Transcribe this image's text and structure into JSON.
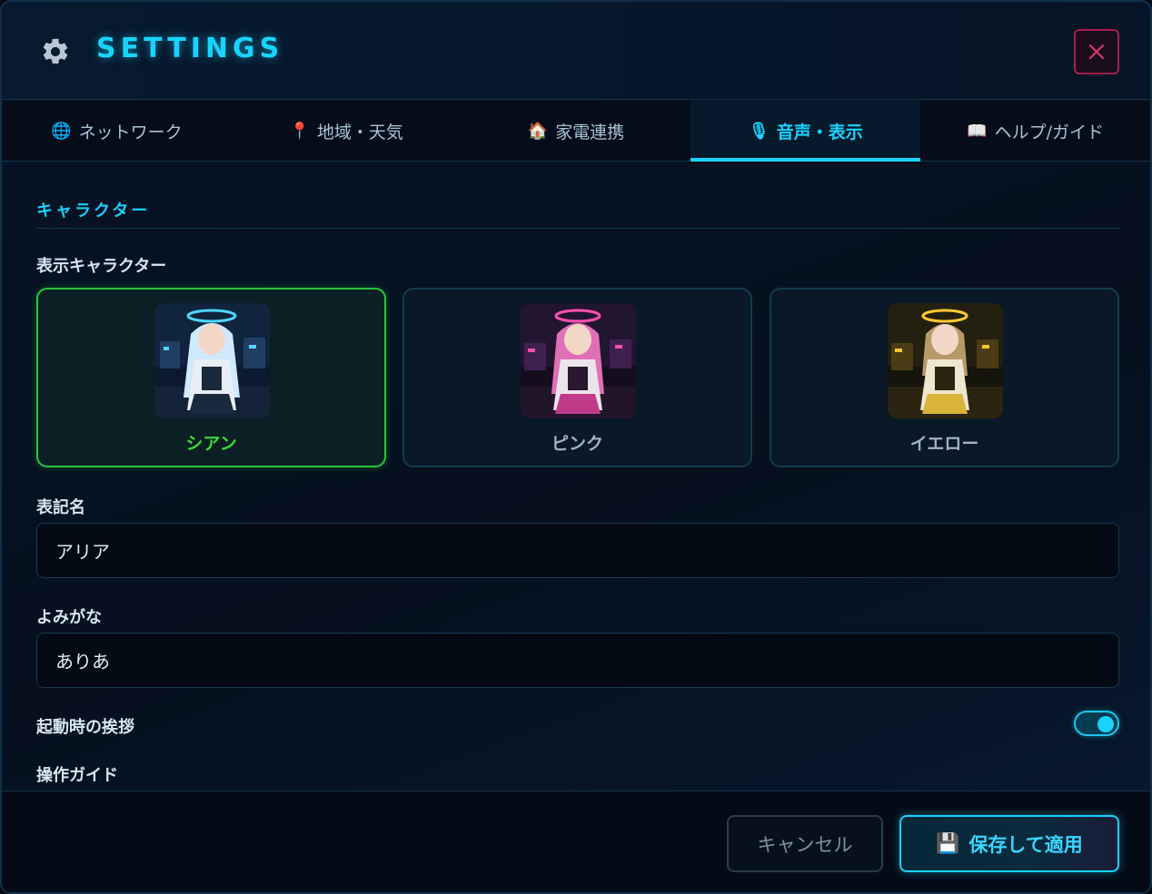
{
  "header": {
    "title": "SETTINGS",
    "icon": "gear-icon"
  },
  "tabs": [
    {
      "label": "ネットワーク",
      "icon": "🌐",
      "active": false
    },
    {
      "label": "地域・天気",
      "icon": "📍",
      "active": false
    },
    {
      "label": "家電連携",
      "icon": "🏠",
      "active": false
    },
    {
      "label": "音声・表示",
      "icon": "🎙",
      "active": true
    },
    {
      "label": "ヘルプ/ガイド",
      "icon": "📖",
      "active": false
    }
  ],
  "section": {
    "title": "キャラクター"
  },
  "character": {
    "label": "表示キャラクター",
    "options": [
      {
        "name": "シアン",
        "selected": true,
        "accent": "#4fd6ff",
        "hair": "#cfe9ff"
      },
      {
        "name": "ピンク",
        "selected": false,
        "accent": "#ff4fb0",
        "hair": "#e06fb8"
      },
      {
        "name": "イエロー",
        "selected": false,
        "accent": "#ffc832",
        "hair": "#b89a6a"
      }
    ]
  },
  "fields": {
    "display_name_label": "表記名",
    "display_name_value": "アリア",
    "reading_label": "よみがな",
    "reading_value": "ありあ"
  },
  "greeting": {
    "label": "起動時の挨拶",
    "enabled": true
  },
  "guide": {
    "label": "操作ガイド"
  },
  "footer": {
    "cancel_label": "キャンセル",
    "save_label": "保存して適用",
    "save_icon": "💾"
  },
  "colors": {
    "accent": "#19d3ff",
    "selected": "#29c63a",
    "close": "#a3204a"
  }
}
